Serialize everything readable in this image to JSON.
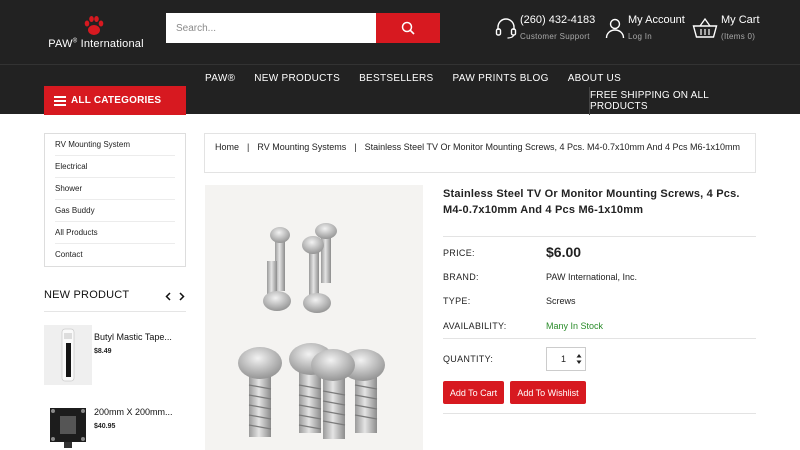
{
  "header": {
    "brand": "PAW",
    "brand_reg": "®",
    "brand_rest": " International",
    "search_placeholder": "Search...",
    "phone": "(260) 432-4183",
    "phone_sub": "Customer Support",
    "account_label": "My Account",
    "account_sub": "Log In",
    "cart_label": "My Cart",
    "cart_sub": "(Items 0)"
  },
  "nav": {
    "all_categories": "ALL CATEGORIES",
    "items": [
      "PAW®",
      "NEW PRODUCTS",
      "BESTSELLERS",
      "PAW PRINTS BLOG",
      "ABOUT US"
    ],
    "shipping": "FREE SHIPPING ON ALL PRODUCTS"
  },
  "sidebar": {
    "categories": [
      "RV Mounting System",
      "Electrical",
      "Shower",
      "Gas Buddy",
      "All Products",
      "Contact"
    ],
    "new_product_title": "NEW PRODUCT",
    "products": [
      {
        "name": "Butyl Mastic Tape...",
        "price": "$8.49"
      },
      {
        "name": "200mm X 200mm...",
        "price": "$40.95"
      }
    ]
  },
  "breadcrumb": {
    "home": "Home",
    "category": "RV Mounting Systems",
    "current": "Stainless Steel TV Or Monitor Mounting Screws, 4 Pcs. M4-0.7x10mm And 4 Pcs M6-1x10mm",
    "separator": "|"
  },
  "product": {
    "title": "Stainless Steel TV Or Monitor Mounting Screws, 4 Pcs. M4-0.7x10mm And 4 Pcs M6-1x10mm",
    "price_label": "PRICE:",
    "price": "$6.00",
    "brand_label": "BRAND:",
    "brand": "PAW International, Inc.",
    "type_label": "TYPE:",
    "type": "Screws",
    "availability_label": "AVAILABILITY:",
    "availability": "Many In Stock",
    "quantity_label": "QUANTITY:",
    "quantity": "1",
    "add_to_cart": "Add To Cart",
    "add_to_wishlist": "Add To Wishlist"
  },
  "colors": {
    "accent": "#d71920",
    "header_bg": "#222222",
    "in_stock": "#2a8c2a"
  }
}
